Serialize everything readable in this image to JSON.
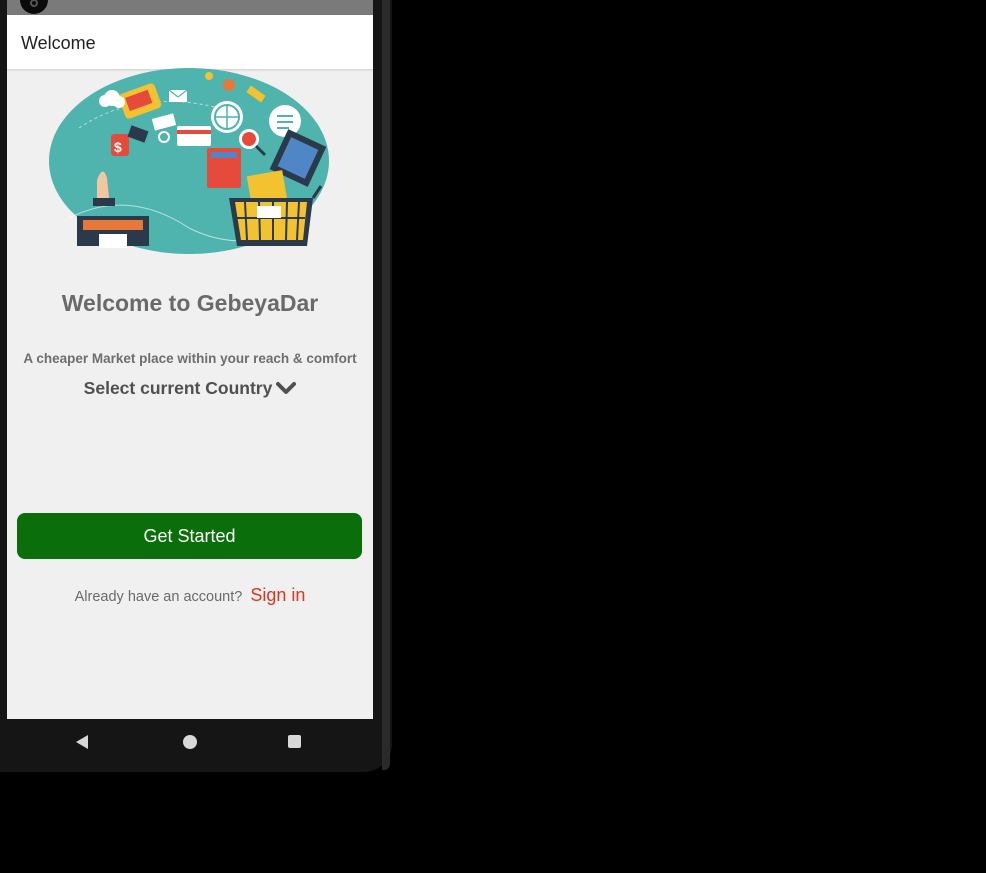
{
  "appbar": {
    "title": "Welcome"
  },
  "welcome": {
    "heading": "Welcome to GebeyaDar",
    "tagline": "A cheaper Market place within your reach & comfort",
    "country_select_label": "Select current Country"
  },
  "actions": {
    "get_started_label": "Get Started",
    "account_prompt": "Already have an account?",
    "sign_in_label": "Sign in"
  },
  "icons": {
    "country_dropdown": "chevron-down-icon",
    "nav_back": "back-triangle-icon",
    "nav_home": "home-circle-icon",
    "nav_recent": "recent-apps-square-icon"
  },
  "colors": {
    "primary_button": "#0a6e0a",
    "sign_in_link": "#d9361e",
    "hero_teal": "#4fb3ae",
    "screen_background": "#f0f0f0"
  }
}
